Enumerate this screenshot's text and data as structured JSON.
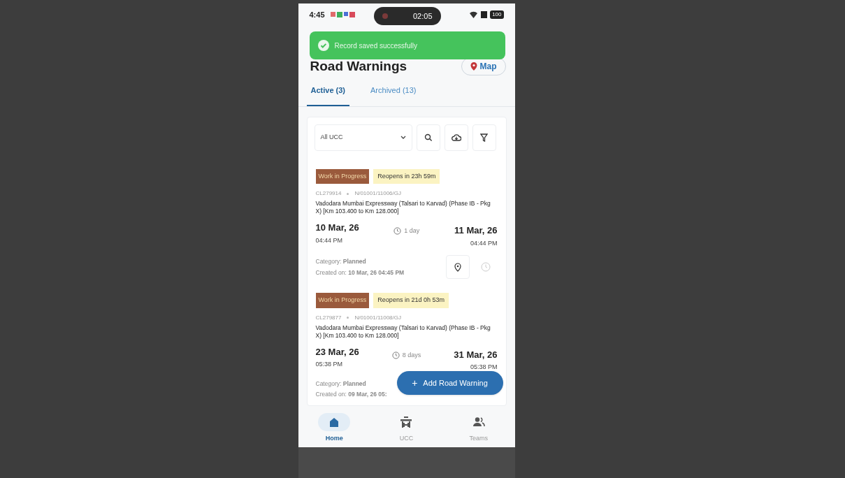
{
  "status_bar": {
    "time": "4:45",
    "timer": "02:05",
    "battery": "100"
  },
  "toast": {
    "message": "Record saved successfully"
  },
  "header": {
    "title": "Road Warnings",
    "map_button": "Map"
  },
  "tabs": [
    {
      "label": "Active (3)",
      "selected": true
    },
    {
      "label": "Archived (13)",
      "selected": false
    }
  ],
  "filter": {
    "dropdown": "All UCC"
  },
  "warnings": [
    {
      "status": "Work in Progress",
      "reopens": "Reopens in 23h 59m",
      "code": "CL279914",
      "ref": "N/01001/11006/GJ",
      "title": "Vadodara Mumbai Expressway (Talsari to Karvad) (Phase IB - Pkg X) [Km 103.400 to Km 128.000]",
      "start_date": "10 Mar, 26",
      "start_time": "04:44 PM",
      "duration": "1 day",
      "end_date": "11 Mar, 26",
      "end_time": "04:44 PM",
      "category": "Category: **Planned**",
      "created": "Created on: **10 Mar, 26 04:45 PM**",
      "actions": true
    },
    {
      "status": "Work in Progress",
      "reopens": "Reopens in 21d 0h 53m",
      "code": "CL279877",
      "ref": "N/01001/11008/GJ",
      "title": "Vadodara Mumbai Expressway (Talsari to Karvad) (Phase IB - Pkg X) [Km 103.400 to Km 128.000]",
      "start_date": "23 Mar, 26",
      "start_time": "05:38 PM",
      "duration": "8 days",
      "end_date": "31 Mar, 26",
      "end_time": "05:38 PM",
      "category": "Category: **Planned**",
      "created": "Created on: **09 Mar, 26 05:**",
      "actions": false
    }
  ],
  "fab": {
    "label": "Add Road Warning",
    "icon": "+"
  },
  "nav": [
    {
      "label": "Home",
      "kind": "home",
      "selected": true
    },
    {
      "label": "UCC",
      "kind": "ucc",
      "selected": false
    },
    {
      "label": "Teams",
      "kind": "teams",
      "selected": false
    }
  ]
}
